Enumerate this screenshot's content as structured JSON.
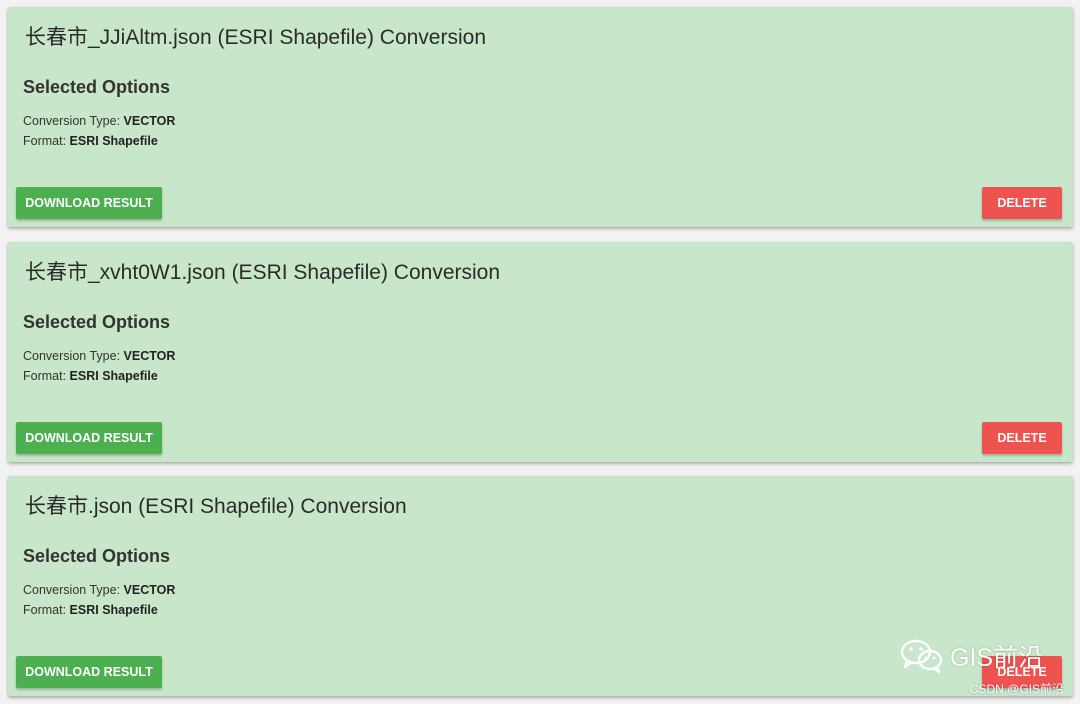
{
  "colors": {
    "page_background": "#f2f2f2",
    "card_background": "#c8e6c9",
    "download_button": "#4caf50",
    "delete_button": "#ef5350"
  },
  "cards": [
    {
      "title": "长春市_JJiAltm.json (ESRI Shapefile) Conversion",
      "options_heading": "Selected Options",
      "conversion_type_label": "Conversion Type: ",
      "conversion_type_value": "VECTOR",
      "format_label": "Format: ",
      "format_value": "ESRI Shapefile",
      "download_label": "DOWNLOAD RESULT",
      "delete_label": "DELETE"
    },
    {
      "title": "长春市_xvht0W1.json (ESRI Shapefile) Conversion",
      "options_heading": "Selected Options",
      "conversion_type_label": "Conversion Type: ",
      "conversion_type_value": "VECTOR",
      "format_label": "Format: ",
      "format_value": "ESRI Shapefile",
      "download_label": "DOWNLOAD RESULT",
      "delete_label": "DELETE"
    },
    {
      "title": "长春市.json (ESRI Shapefile) Conversion",
      "options_heading": "Selected Options",
      "conversion_type_label": "Conversion Type: ",
      "conversion_type_value": "VECTOR",
      "format_label": "Format: ",
      "format_value": "ESRI Shapefile",
      "download_label": "DOWNLOAD RESULT",
      "delete_label": "DELETE"
    }
  ],
  "watermark": {
    "icon": "wechat-icon",
    "text": "GIS前沿",
    "credit": "CSDN @GIS前沿"
  }
}
